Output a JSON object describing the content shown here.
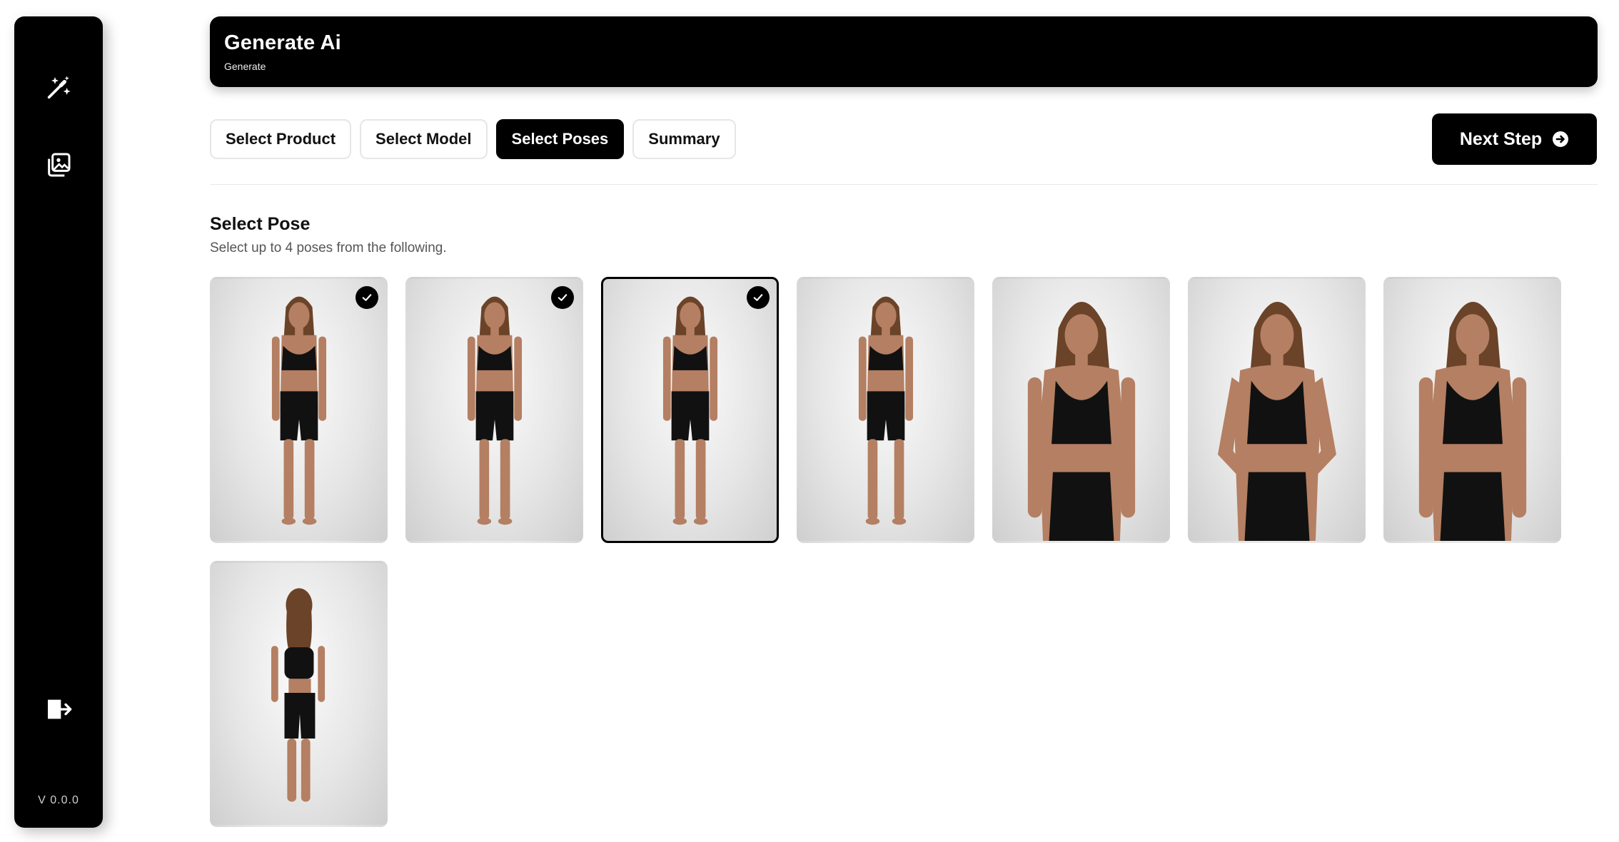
{
  "sidebar": {
    "items": [
      {
        "icon": "magic-wand-icon"
      },
      {
        "icon": "gallery-icon"
      }
    ],
    "logout_icon": "logout-icon",
    "version": "V 0.0.0"
  },
  "header": {
    "title": "Generate Ai",
    "subtitle": "Generate"
  },
  "steps": [
    {
      "label": "Select Product",
      "active": false
    },
    {
      "label": "Select Model",
      "active": false
    },
    {
      "label": "Select Poses",
      "active": true
    },
    {
      "label": "Summary",
      "active": false
    }
  ],
  "next_button": {
    "label": "Next Step",
    "icon": "arrow-right-circle-icon"
  },
  "section": {
    "title": "Select Pose",
    "subtitle": "Select up to 4 poses from the following."
  },
  "poses": [
    {
      "shot": "full-front",
      "selected": true
    },
    {
      "shot": "full-front",
      "selected": true
    },
    {
      "shot": "full-front",
      "selected": true,
      "focused": true
    },
    {
      "shot": "full-angled",
      "selected": false
    },
    {
      "shot": "close-front",
      "selected": false
    },
    {
      "shot": "close-hand-hip",
      "selected": false
    },
    {
      "shot": "close-three-quarter",
      "selected": false
    },
    {
      "shot": "full-back",
      "selected": false
    }
  ],
  "colors": {
    "accent": "#000000",
    "background": "#ffffff",
    "border": "#e6e6e6"
  }
}
